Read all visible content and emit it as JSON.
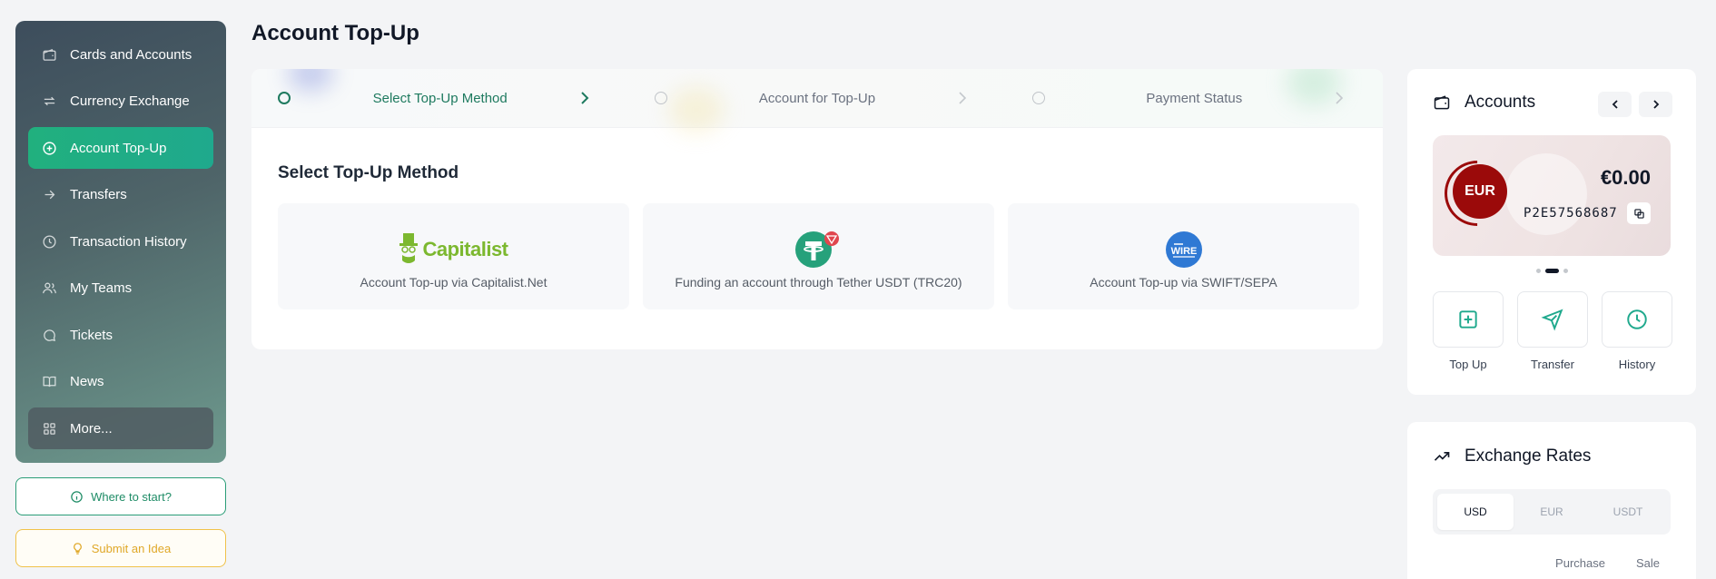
{
  "page": {
    "title": "Account Top-Up"
  },
  "sidebar": {
    "items": [
      {
        "label": "Cards and Accounts",
        "icon": "wallet-icon"
      },
      {
        "label": "Currency Exchange",
        "icon": "exchange-icon"
      },
      {
        "label": "Account Top-Up",
        "icon": "plus-circle-icon",
        "active": true
      },
      {
        "label": "Transfers",
        "icon": "arrow-right-icon"
      },
      {
        "label": "Transaction History",
        "icon": "clock-icon"
      },
      {
        "label": "My Teams",
        "icon": "users-icon"
      },
      {
        "label": "Tickets",
        "icon": "chat-icon"
      },
      {
        "label": "News",
        "icon": "book-icon"
      },
      {
        "label": "More...",
        "icon": "grid-icon"
      }
    ],
    "where_to_start": "Where to start?",
    "submit_idea": "Submit an Idea"
  },
  "stepper": {
    "steps": [
      {
        "label": "Select Top-Up Method",
        "active": true
      },
      {
        "label": "Account for Top-Up",
        "active": false
      },
      {
        "label": "Payment Status",
        "active": false
      }
    ]
  },
  "methods": {
    "title": "Select Top-Up Method",
    "items": [
      {
        "logo_text": "Capitalist",
        "label": "Account Top-up via Capitalist.Net"
      },
      {
        "logo_text": "T",
        "label": "Funding an account through Tether USDT (TRC20)"
      },
      {
        "logo_text": "WIRE",
        "label": "Account Top-up via SWIFT/SEPA"
      }
    ]
  },
  "accounts": {
    "title": "Accounts",
    "card": {
      "currency": "EUR",
      "balance": "€0.00",
      "number": "P2E57568687",
      "color": "#9b0a0a"
    },
    "actions": [
      {
        "label": "Top Up",
        "icon": "plus-square-icon"
      },
      {
        "label": "Transfer",
        "icon": "send-icon"
      },
      {
        "label": "History",
        "icon": "clock-icon"
      }
    ]
  },
  "rates": {
    "title": "Exchange Rates",
    "tabs": [
      {
        "label": "USD",
        "active": true
      },
      {
        "label": "EUR",
        "active": false
      },
      {
        "label": "USDT",
        "active": false
      }
    ],
    "columns": [
      "Purchase",
      "Sale"
    ]
  },
  "colors": {
    "accent": "#1fa98d",
    "accent_dark": "#1e7a5f",
    "capitalist": "#7cb82f",
    "tether": "#26a17b",
    "wire": "#2f79d4"
  }
}
